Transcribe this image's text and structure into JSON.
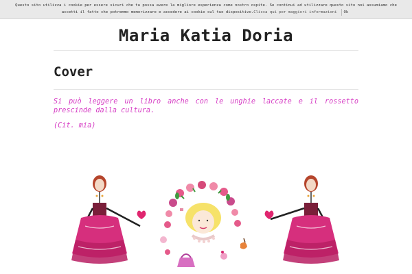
{
  "cookie_banner": {
    "line1": "Questo sito utilizza i cookie per essere sicuri che tu possa avere la migliore esperienza come nostro ospite. Se continui ad utilizzare questo sito noi assumiamo che",
    "line2_text": "accetti il fatto che potremmo memorizzare e accedere ai cookie sul tuo dispositivo.",
    "more_link": "Clicca qui per maggiori informazioni",
    "ok_label": "Ok"
  },
  "site": {
    "title": "Maria Katia Doria"
  },
  "page": {
    "title": "Cover",
    "quote": "Si può leggere un libro anche con le unghie laccate e il rossetto prescinde dalla cultura.",
    "citation": "(Cit. mia)"
  },
  "colors": {
    "accent": "#d63dc4",
    "title": "#222222"
  }
}
